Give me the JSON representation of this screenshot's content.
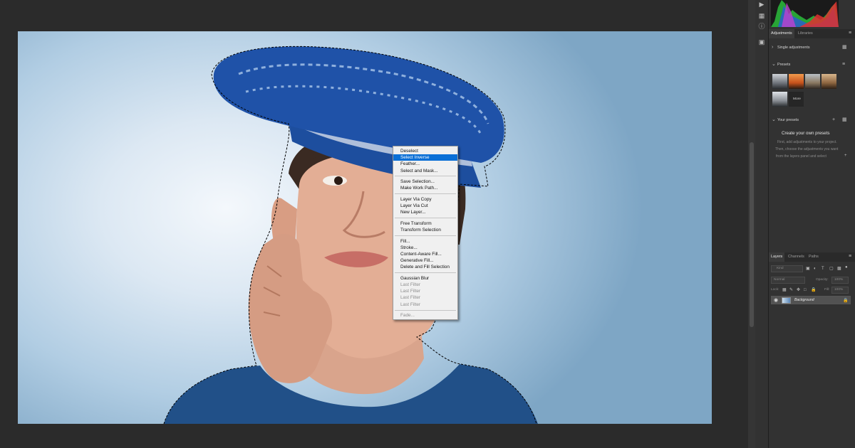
{
  "context_menu": {
    "items": [
      {
        "label": "Deselect",
        "state": "normal"
      },
      {
        "label": "Select Inverse",
        "state": "highlighted"
      },
      {
        "label": "Feather...",
        "state": "normal"
      },
      {
        "label": "Select and Mask...",
        "state": "normal"
      },
      {
        "label": "Save Selection...",
        "state": "normal"
      },
      {
        "label": "Make Work Path...",
        "state": "normal"
      },
      {
        "label": "Layer Via Copy",
        "state": "normal"
      },
      {
        "label": "Layer Via Cut",
        "state": "normal"
      },
      {
        "label": "New Layer...",
        "state": "normal"
      },
      {
        "label": "Free Transform",
        "state": "normal"
      },
      {
        "label": "Transform Selection",
        "state": "normal"
      },
      {
        "label": "Fill...",
        "state": "normal"
      },
      {
        "label": "Stroke...",
        "state": "normal"
      },
      {
        "label": "Content-Aware Fill...",
        "state": "normal"
      },
      {
        "label": "Generative Fill...",
        "state": "normal"
      },
      {
        "label": "Delete and Fill Selection",
        "state": "normal"
      },
      {
        "label": "Gaussian Blur",
        "state": "normal"
      },
      {
        "label": "Last Filter",
        "state": "disabled"
      },
      {
        "label": "Last Filter",
        "state": "disabled"
      },
      {
        "label": "Last Filter",
        "state": "disabled"
      },
      {
        "label": "Last Filter",
        "state": "disabled"
      },
      {
        "label": "Fade...",
        "state": "disabled"
      }
    ],
    "separators_after": [
      3,
      5,
      8,
      10,
      15,
      20
    ]
  },
  "adjustments_panel": {
    "tabs": [
      "Adjustments",
      "Libraries"
    ],
    "single_adjustments": "Single adjustments",
    "presets_title": "Presets",
    "more_label": "More",
    "your_presets_title": "Your presets",
    "create_title": "Create your own presets",
    "create_line1": "First, add adjustments to your project.",
    "create_line2": "Then, choose the adjustments you want",
    "create_line3": "from the layers panel and select"
  },
  "layers_panel": {
    "tabs": [
      "Layers",
      "Channels",
      "Paths"
    ],
    "filter_placeholder": "Kind",
    "blend_mode": "Normal",
    "opacity_label": "Opacity:",
    "opacity_value": "100%",
    "lock_label": "Lock:",
    "fill_label": "Fill:",
    "fill_value": "100%",
    "layer_name": "Background"
  },
  "colors": {
    "highlight": "#0a6fd6",
    "hat_blue": "#1f52a8",
    "shirt_blue": "#215088"
  }
}
